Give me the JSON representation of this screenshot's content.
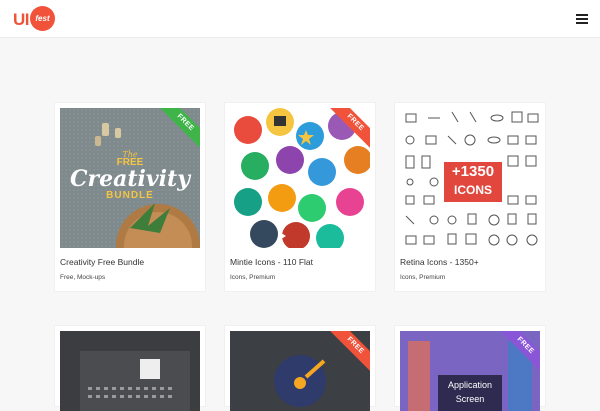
{
  "header": {
    "logo_text": "UI",
    "logo_badge": "fest",
    "menu_icon": "hamburger-menu-icon"
  },
  "colors": {
    "brand": "#f0533a",
    "free_green": "#3fb549",
    "free_orange": "#f0533a",
    "free_purple": "#8a56d8"
  },
  "cards": [
    {
      "title": "Creativity Free Bundle",
      "tags": "Free, Mock-ups",
      "badge": "FREE",
      "art": {
        "line1": "The",
        "line2": "FREE",
        "line3": "Creativity",
        "line4": "BUNDLE"
      }
    },
    {
      "title": "Mintie Icons - 110 Flat",
      "tags": "Icons, Premium",
      "badge": "FREE"
    },
    {
      "title": "Retina Icons - 1350+",
      "tags": "Icons, Premium",
      "art": {
        "line1": "+1350",
        "line2": "ICONS"
      }
    }
  ],
  "row2": [
    {
      "badge": ""
    },
    {
      "badge": "FREE"
    },
    {
      "badge": "FREE",
      "art": {
        "line1": "Application",
        "line2": "Screen"
      }
    }
  ]
}
